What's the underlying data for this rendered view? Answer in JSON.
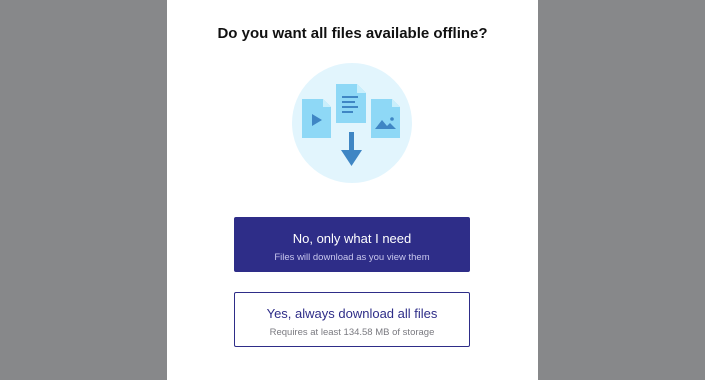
{
  "dialog": {
    "title": "Do you want all files available offline?",
    "illustration": {
      "icons": [
        "video-file-icon",
        "document-file-icon",
        "image-file-icon",
        "download-arrow-icon"
      ]
    },
    "options": [
      {
        "title": "No, only what I need",
        "subtitle": "Files will download as you view them",
        "selected": true
      },
      {
        "title": "Yes, always download all files",
        "subtitle": "Requires at least 134.58 MB of storage",
        "selected": false
      }
    ]
  },
  "colors": {
    "backdrop": "#87888a",
    "accent": "#2e2d88",
    "illustration_bg": "#e2f5fd",
    "file_fill": "#8ed8f6",
    "file_glyph": "#3f86c4"
  }
}
